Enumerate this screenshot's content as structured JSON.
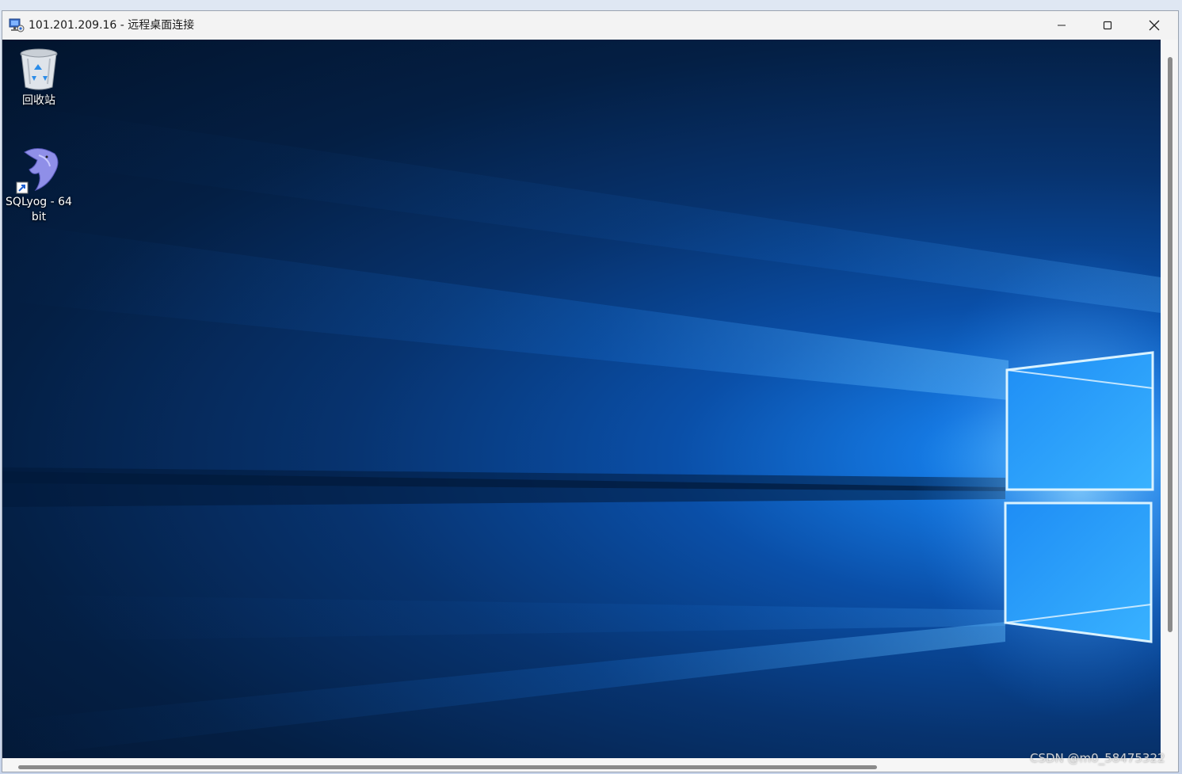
{
  "window": {
    "title": "101.201.209.16 - 远程桌面连接",
    "app_icon": "remote-desktop-icon",
    "controls": {
      "minimize": "minimize-icon",
      "maximize": "maximize-icon",
      "close": "close-icon"
    }
  },
  "desktop": {
    "wallpaper": "windows-10-hero-wallpaper",
    "icons": [
      {
        "label": "回收站",
        "icon": "recycle-bin-icon"
      },
      {
        "label_line1": "SQLyog - 64",
        "label_line2": "bit",
        "icon": "sqlyog-dolphin-icon",
        "shortcut": true
      }
    ]
  },
  "watermark": "CSDN @m0_58475322",
  "colors": {
    "titlebar": "#f3f3f3",
    "wallpaper_dark": "#02142d",
    "wallpaper_light": "#2fa6ff"
  }
}
